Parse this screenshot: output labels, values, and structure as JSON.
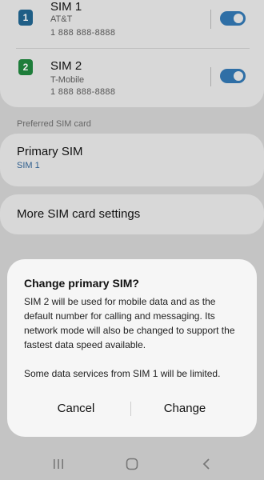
{
  "sims": [
    {
      "badge": "1",
      "title": "SIM 1",
      "carrier": "AT&T",
      "number": "1 888 888-8888",
      "enabled": true,
      "badge_color": "#1f5e86"
    },
    {
      "badge": "2",
      "title": "SIM 2",
      "carrier": "T-Mobile",
      "number": "1 888 888-8888",
      "enabled": true,
      "badge_color": "#1e7d3a"
    }
  ],
  "preferred_section": {
    "label": "Preferred SIM card"
  },
  "primary_sim": {
    "title": "Primary SIM",
    "value": "SIM 1"
  },
  "more_settings": {
    "title": "More SIM card settings"
  },
  "dialog": {
    "title": "Change primary SIM?",
    "body1": "SIM 2 will be used for mobile data and as the default number for calling and messaging. Its network mode will also be changed to support the fastest data speed available.",
    "body2": "Some data services from SIM 1 will be limited.",
    "cancel_label": "Cancel",
    "confirm_label": "Change"
  },
  "navbar": {
    "recents_icon": "recents-icon",
    "home_icon": "home-icon",
    "back_icon": "back-icon"
  },
  "colors": {
    "accent": "#2f6fa6",
    "link": "#2f5f8e"
  }
}
